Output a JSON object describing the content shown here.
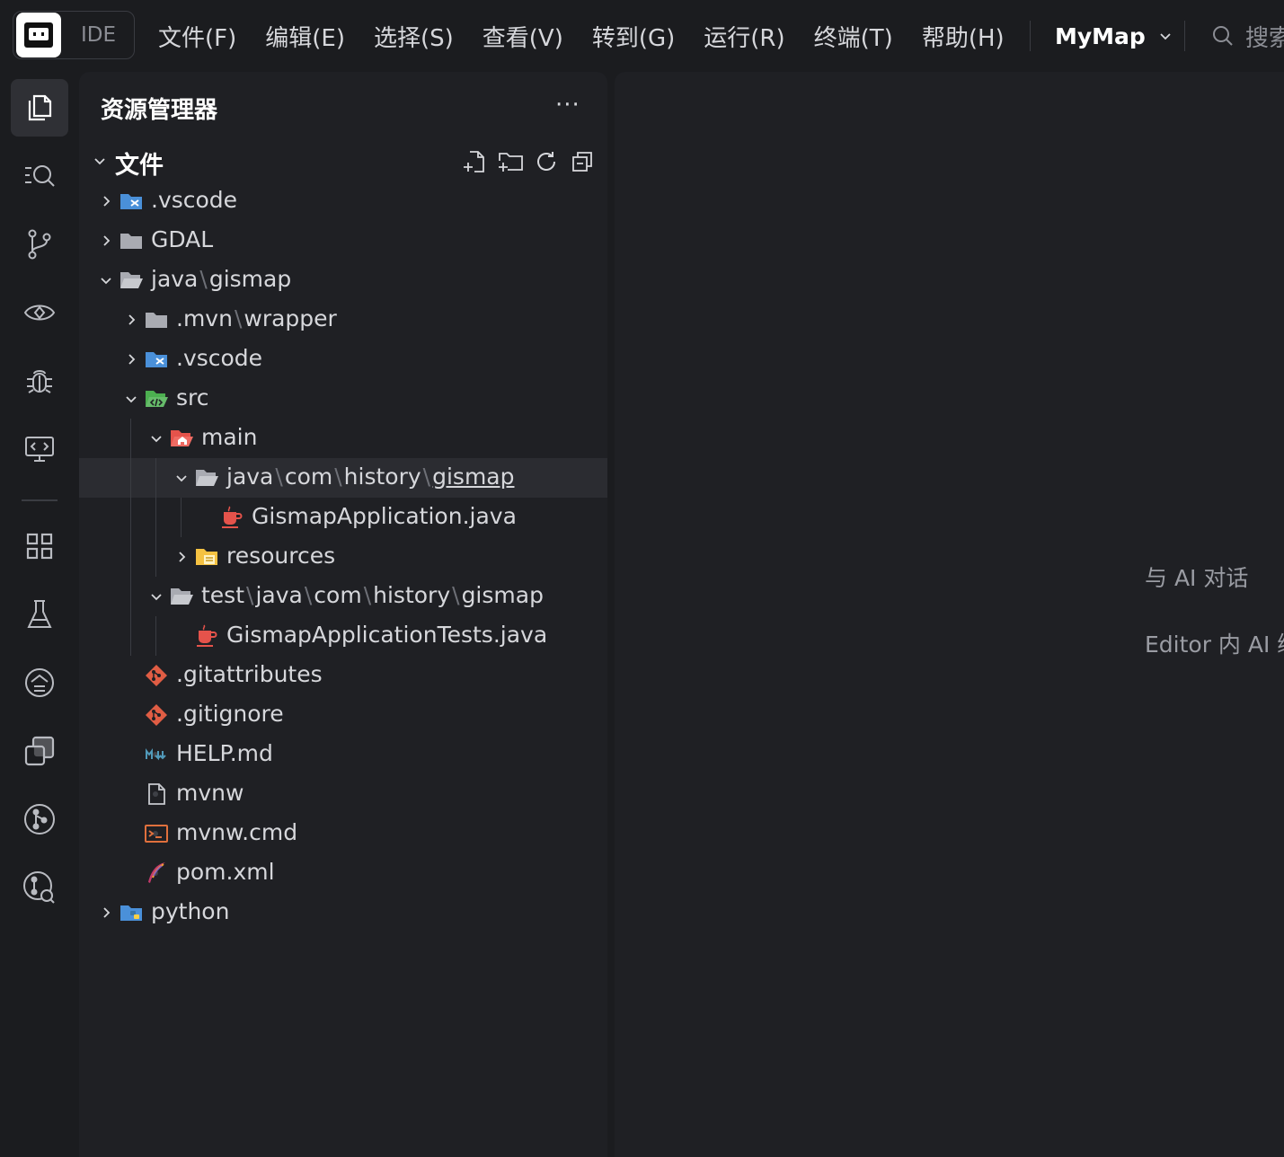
{
  "topbar": {
    "brand_label": "IDE",
    "menu": [
      "文件(F)",
      "编辑(E)",
      "选择(S)",
      "查看(V)",
      "转到(G)",
      "运行(R)",
      "终端(T)",
      "帮助(H)"
    ],
    "project_name": "MyMap",
    "search_label": "搜索"
  },
  "activity_bar": {
    "icons": [
      "explorer-icon",
      "search-icon",
      "source-control-icon",
      "preview-icon",
      "debug-icon",
      "remote-icon",
      "extensions-icon",
      "testing-icon",
      "ai-icon",
      "copy-icon",
      "git-graph-icon",
      "git-search-icon"
    ]
  },
  "explorer": {
    "title": "资源管理器",
    "more": "···",
    "section_title": "文件",
    "tree": [
      {
        "label": ".vscode",
        "depth": 0,
        "kind": "folder-vscode",
        "expanded": false
      },
      {
        "label": "GDAL",
        "depth": 0,
        "kind": "folder",
        "expanded": false
      },
      {
        "parts": [
          "java",
          "gismap"
        ],
        "depth": 0,
        "kind": "folder-open",
        "expanded": true
      },
      {
        "parts": [
          ".mvn",
          "wrapper"
        ],
        "depth": 1,
        "kind": "folder",
        "expanded": false
      },
      {
        "label": ".vscode",
        "depth": 1,
        "kind": "folder-vscode",
        "expanded": false
      },
      {
        "label": "src",
        "depth": 1,
        "kind": "folder-src",
        "expanded": true
      },
      {
        "label": "main",
        "depth": 2,
        "kind": "folder-main",
        "expanded": true
      },
      {
        "parts": [
          "java",
          "com",
          "history",
          "gismap"
        ],
        "depth": 3,
        "kind": "folder-open",
        "expanded": true,
        "selected": true
      },
      {
        "label": "GismapApplication.java",
        "depth": 4,
        "kind": "java",
        "file": true
      },
      {
        "label": "resources",
        "depth": 3,
        "kind": "folder-resources",
        "expanded": false
      },
      {
        "parts": [
          "test",
          "java",
          "com",
          "history",
          "gismap"
        ],
        "depth": 2,
        "kind": "folder-open",
        "expanded": true
      },
      {
        "label": "GismapApplicationTests.java",
        "depth": 3,
        "kind": "java",
        "file": true
      },
      {
        "label": ".gitattributes",
        "depth": 1,
        "kind": "git",
        "file": true
      },
      {
        "label": ".gitignore",
        "depth": 1,
        "kind": "git",
        "file": true
      },
      {
        "label": "HELP.md",
        "depth": 1,
        "kind": "markdown",
        "file": true
      },
      {
        "label": "mvnw",
        "depth": 1,
        "kind": "file",
        "file": true
      },
      {
        "label": "mvnw.cmd",
        "depth": 1,
        "kind": "cmd",
        "file": true
      },
      {
        "label": "pom.xml",
        "depth": 1,
        "kind": "maven",
        "file": true
      },
      {
        "label": "python",
        "depth": 0,
        "kind": "folder-python",
        "expanded": false
      }
    ]
  },
  "editor": {
    "hint_chat": "与 AI 对话",
    "hint_inline": "Editor 内 AI 编"
  },
  "colors": {
    "background": "#1b1c1f",
    "panel": "#1f2024",
    "selected_row": "#2b2c31",
    "text": "#d6d7db",
    "muted": "#8b8d94"
  }
}
